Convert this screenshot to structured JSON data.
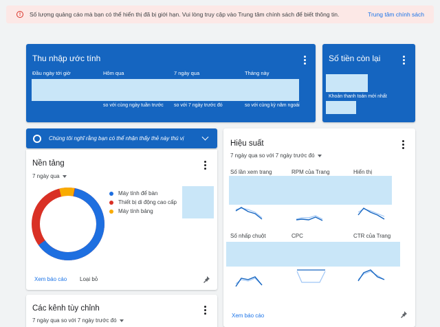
{
  "alert": {
    "icon": "alert-circle-icon",
    "message": "Số lượng quảng cáo mà bạn có thể hiển thị đã bị giới hạn. Vui lòng truy cập vào Trung tâm chính sách để biết thông tin.",
    "link": "Trung tâm chính sách"
  },
  "earnings": {
    "title": "Thu nhập ước tính",
    "columns": [
      {
        "label": "Đầu ngày tới giờ",
        "compare": ""
      },
      {
        "label": "Hôm qua",
        "compare": "so với cùng ngày tuần trước"
      },
      {
        "label": "7 ngày qua",
        "compare": "so với 7 ngày trước đó"
      },
      {
        "label": "Tháng này",
        "compare": "so với cùng kỳ năm ngoái"
      }
    ]
  },
  "balance": {
    "title": "Số tiền còn lại",
    "last_payment": "Khoản thanh toán mới nhất"
  },
  "suggestion": {
    "icon": "settings-gear-icon",
    "text": "Chúng tôi nghĩ rằng bạn có thể nhận thấy thẻ này thú vị"
  },
  "platform": {
    "title": "Nền tảng",
    "range": "7 ngày qua",
    "legend": [
      {
        "label": "Máy tính để bàn",
        "color": "#1e6fe0"
      },
      {
        "label": "Thiết bị di động cao cấp",
        "color": "#d93025"
      },
      {
        "label": "Máy tính bảng",
        "color": "#f9ab00"
      }
    ],
    "view_report": "Xem báo cáo",
    "dismiss": "Loại bỏ"
  },
  "performance": {
    "title": "Hiệu suất",
    "range": "7 ngày qua so với 7 ngày trước đó",
    "metrics": [
      "Số lần xem trang",
      "RPM của Trang",
      "Hiển thị",
      "Số nhấp chuột",
      "CPC",
      "CTR của Trang"
    ],
    "view_report": "Xem báo cáo"
  },
  "custom_channels": {
    "title": "Các kênh tùy chỉnh",
    "range": "7 ngày qua so với 7 ngày trước đó"
  },
  "colors": {
    "accent": "#1565c0",
    "link": "#1a73e8",
    "redacted": "#c9e6f8"
  }
}
